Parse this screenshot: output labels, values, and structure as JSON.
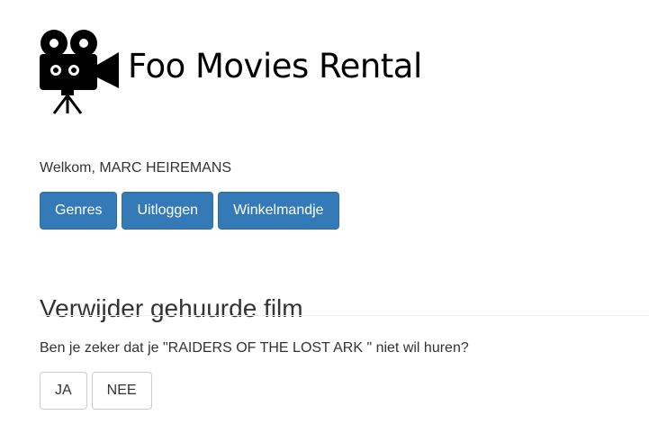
{
  "header": {
    "logo_icon": "movie-camera-icon",
    "title": "Foo Movies Rental"
  },
  "welcome": {
    "text": "Welkom, MARC HEIREMANS"
  },
  "nav": {
    "genres_label": "Genres",
    "logout_label": "Uitloggen",
    "cart_label": "Winkelmandje"
  },
  "main": {
    "heading": "Verwijder gehuurde film",
    "question": "Ben je zeker dat je \"RAIDERS OF THE LOST ARK \" niet wil huren?",
    "yes_label": "JA",
    "no_label": "NEE"
  },
  "colors": {
    "primary": "#337ab7",
    "primary_border": "#2e6da4",
    "text": "#333333",
    "divider": "#eeeeee"
  }
}
